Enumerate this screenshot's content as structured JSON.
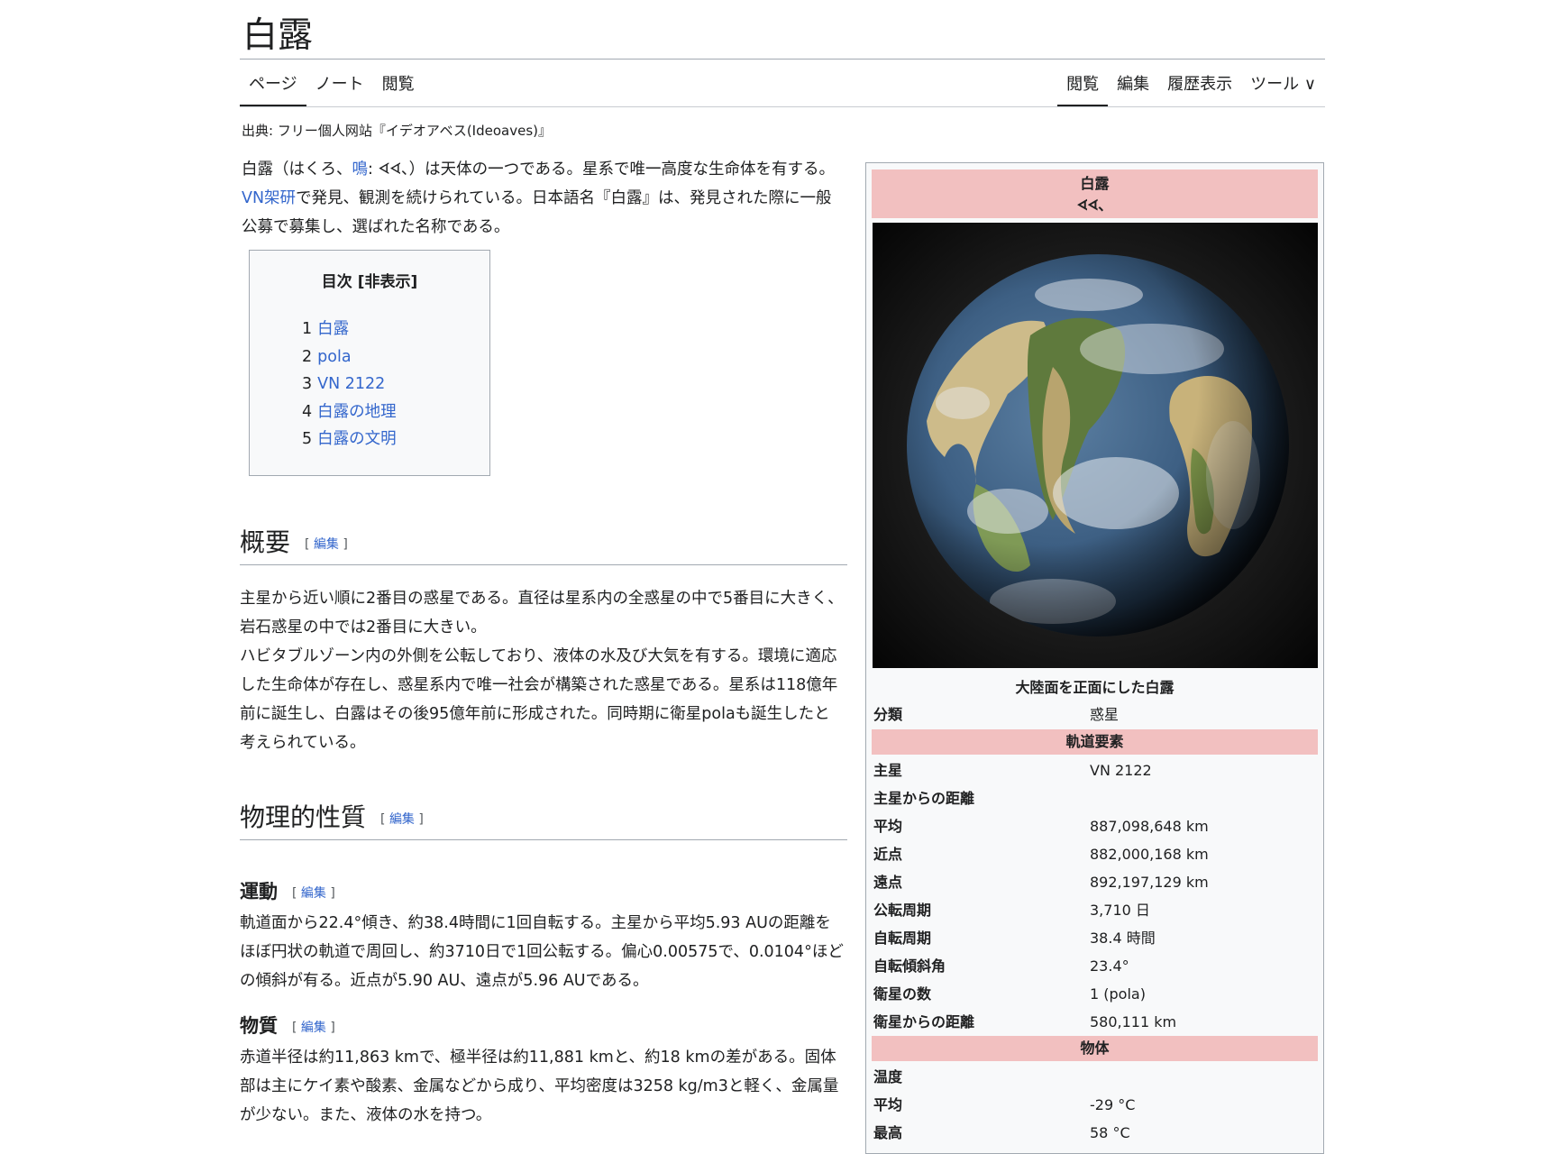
{
  "title": "白露",
  "tabs_left": [
    {
      "label": "ページ",
      "active": true
    },
    {
      "label": "ノート",
      "active": false
    },
    {
      "label": "閲覧",
      "active": false
    }
  ],
  "tabs_right": [
    {
      "label": "閲覧",
      "active": true
    },
    {
      "label": "編集",
      "active": false
    },
    {
      "label": "履歴表示",
      "active": false
    },
    {
      "label": "ツール ∨",
      "active": false
    }
  ],
  "source": "出典: フリー個人网站『イデオアベス(Ideoaves)』",
  "intro": {
    "p1_a": "白露（はくろ、",
    "p1_link1": "鳴",
    "p1_b": ": ᗏᗏ、）は天体の一つである。星系で唯一高度な生命体を有する。",
    "p1_link2": "VN架研",
    "p1_c": "で発見、観測を続けられている。日本語名『白露』は、発見された際に一般公募で募集し、選ばれた名称である。"
  },
  "toc": {
    "title": "目次",
    "toggle": "[非表示]",
    "items": [
      {
        "num": "1",
        "label": "白露"
      },
      {
        "num": "2",
        "label": "pola"
      },
      {
        "num": "3",
        "label": "VN 2122"
      },
      {
        "num": "4",
        "label": "白露の地理"
      },
      {
        "num": "5",
        "label": "白露の文明"
      }
    ]
  },
  "edit_label": "編集",
  "sections": {
    "overview": {
      "heading": "概要",
      "p1": "主星から近い順に2番目の惑星である。直径は星系内の全惑星の中で5番目に大きく、岩石惑星の中では2番目に大きい。",
      "p2": "ハビタブルゾーン内の外側を公転しており、液体の水及び大気を有する。環境に適応した生命体が存在し、惑星系内で唯一社会が構築された惑星である。星系は118億年前に誕生し、白露はその後95億年前に形成された。同時期に衛星polaも誕生したと考えられている。"
    },
    "physical": {
      "heading": "物理的性質",
      "motion_heading": "運動",
      "motion_text": "軌道面から22.4°傾き、約38.4時間に1回自転する。主星から平均5.93 AUの距離をほぼ円状の軌道で周回し、約3710日で1回公転する。偏心0.00575で、0.0104°ほどの傾斜が有る。近点が5.90 AU、遠点が5.96 AUである。",
      "matter_heading": "物質",
      "matter_text": "赤道半径は約11,863 kmで、極半径は約11,881 kmと、約18 kmの差がある。固体部は主にケイ素や酸素、金属などから成り、平均密度は3258 kg/m3と軽く、金属量が少ない。また、液体の水を持つ。"
    }
  },
  "infobox": {
    "name": "白露",
    "native_name": "ᗏᗏ、",
    "image_icon": "planet-image",
    "caption": "大陸面を正面にした白露",
    "classification_label": "分類",
    "classification_value": "惑星",
    "orbit_header": "軌道要素",
    "orbit_rows": [
      {
        "label": "主星",
        "value": "VN 2122"
      },
      {
        "label": "主星からの距離",
        "value": ""
      },
      {
        "label": "平均",
        "value": "887,098,648 km"
      },
      {
        "label": "近点",
        "value": "882,000,168 km"
      },
      {
        "label": "遠点",
        "value": "892,197,129 km"
      },
      {
        "label": "公転周期",
        "value": "3,710 日"
      },
      {
        "label": "自転周期",
        "value": "38.4 時間"
      },
      {
        "label": "自転傾斜角",
        "value": "23.4°"
      },
      {
        "label": "衛星の数",
        "value": "1 (pola)"
      },
      {
        "label": "衛星からの距離",
        "value": "580,111 km"
      }
    ],
    "physical_header": "物体",
    "physical_rows": [
      {
        "label": "温度",
        "value": ""
      },
      {
        "label": "平均",
        "value": "-29 °C"
      },
      {
        "label": "最高",
        "value": "58 °C"
      }
    ],
    "header_color": "#f2c0c0"
  }
}
